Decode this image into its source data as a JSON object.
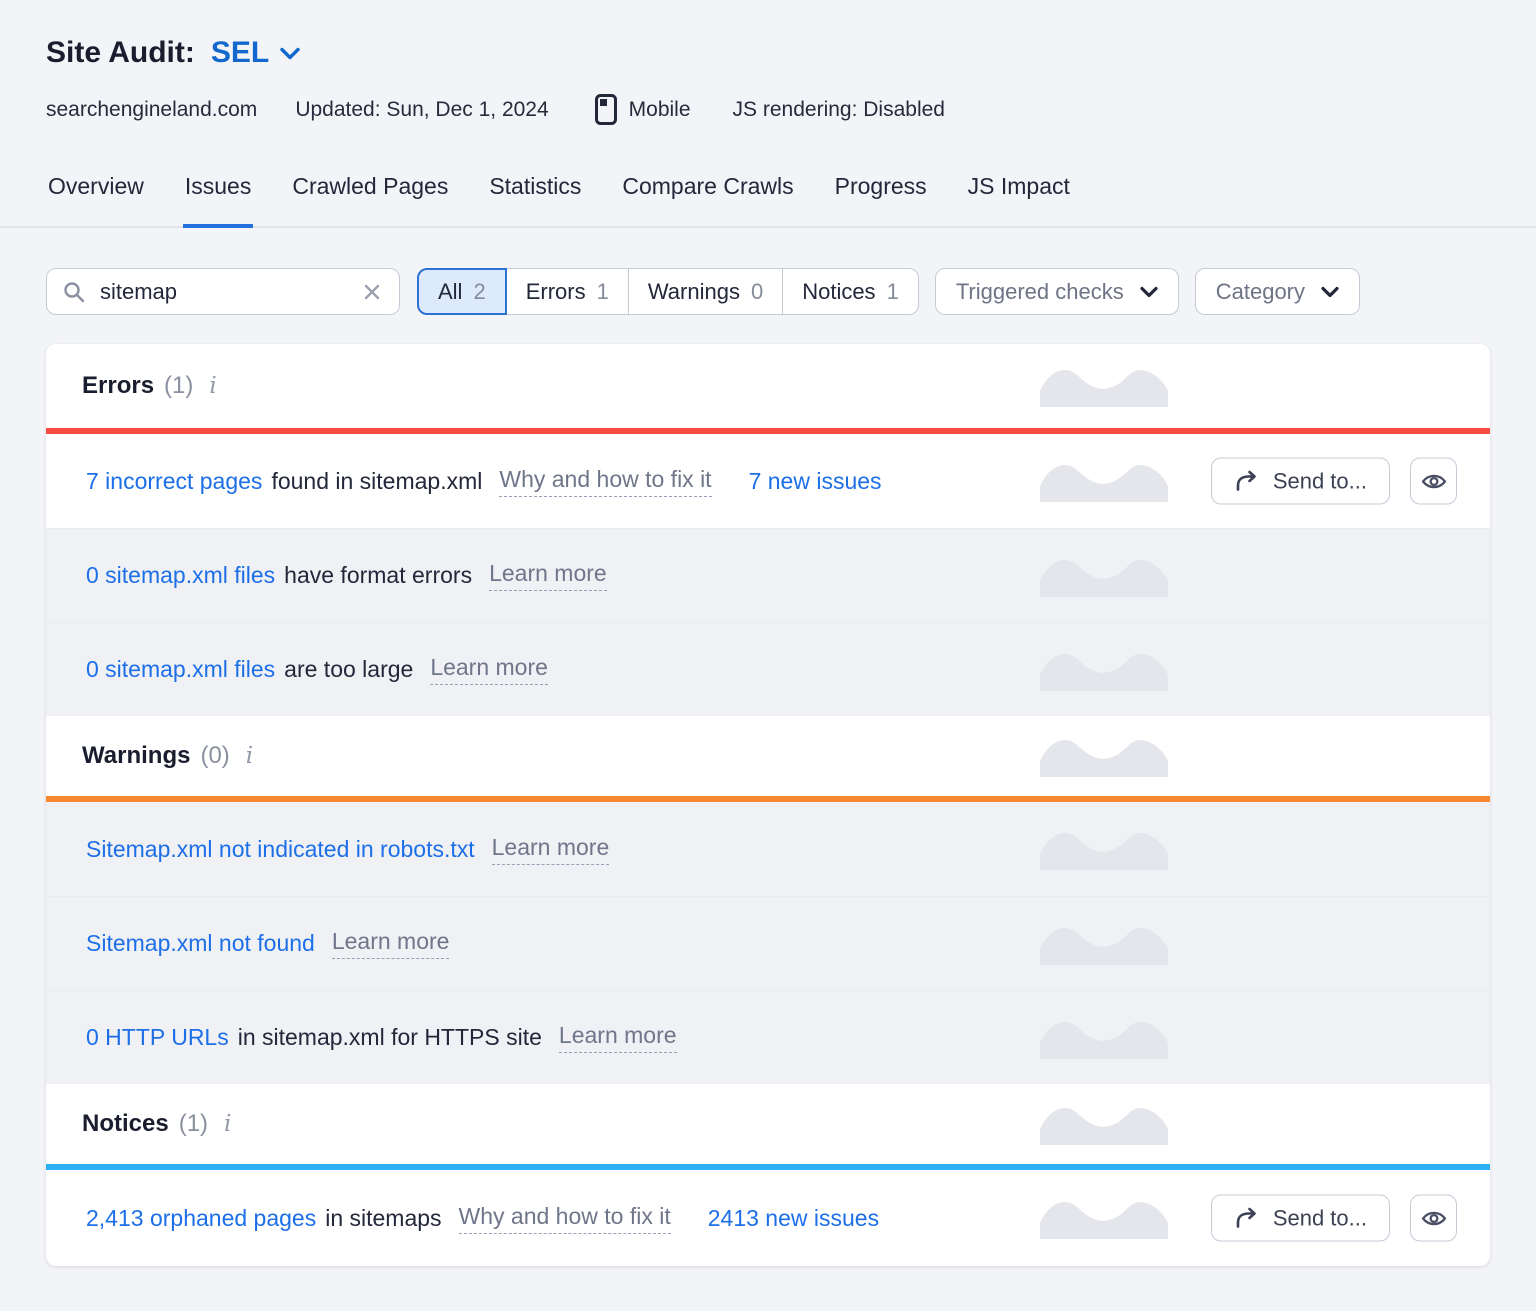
{
  "page": {
    "title_prefix": "Site Audit:",
    "project": "SEL",
    "domain": "searchengineland.com",
    "updated": "Updated: Sun, Dec 1, 2024",
    "device": "Mobile",
    "js_rendering": "JS rendering: Disabled"
  },
  "tabs": [
    {
      "label": "Overview",
      "active": false
    },
    {
      "label": "Issues",
      "active": true
    },
    {
      "label": "Crawled Pages",
      "active": false
    },
    {
      "label": "Statistics",
      "active": false
    },
    {
      "label": "Compare Crawls",
      "active": false
    },
    {
      "label": "Progress",
      "active": false
    },
    {
      "label": "JS Impact",
      "active": false
    }
  ],
  "filters": {
    "search": {
      "value": "sitemap"
    },
    "segments": [
      {
        "label": "All",
        "count": "2",
        "selected": true
      },
      {
        "label": "Errors",
        "count": "1",
        "selected": false
      },
      {
        "label": "Warnings",
        "count": "0",
        "selected": false
      },
      {
        "label": "Notices",
        "count": "1",
        "selected": false
      }
    ],
    "triggered_checks_label": "Triggered checks",
    "category_label": "Category"
  },
  "actions": {
    "send_to": "Send to..."
  },
  "colors": {
    "link_blue": "#1d6fe8",
    "error_accent": "#fa4b42",
    "warning_accent": "#f8872e",
    "notice_accent": "#2db1f5"
  },
  "sections": [
    {
      "title": "Errors",
      "count": "(1)",
      "accent_color": "#fa4b42",
      "rows": [
        {
          "link": "7 incorrect pages",
          "text": "found in sitemap.xml",
          "help": "Why and how to fix it",
          "new_issues": "7 new issues"
        },
        {
          "link": "0 sitemap.xml files",
          "text": "have format errors",
          "help": "Learn more"
        },
        {
          "link": "0 sitemap.xml files",
          "text": "are too large",
          "help": "Learn more"
        }
      ]
    },
    {
      "title": "Warnings",
      "count": "(0)",
      "accent_color": "#f8872e",
      "rows": [
        {
          "link": "Sitemap.xml not indicated in robots.txt",
          "help": "Learn more"
        },
        {
          "link": "Sitemap.xml not found",
          "help": "Learn more"
        },
        {
          "link": "0 HTTP URLs",
          "text": "in sitemap.xml for HTTPS site",
          "help": "Learn more"
        }
      ]
    },
    {
      "title": "Notices",
      "count": "(1)",
      "accent_color": "#2db1f5",
      "rows": [
        {
          "link": "2,413 orphaned pages",
          "text": "in sitemaps",
          "help": "Why and how to fix it",
          "new_issues": "2413 new issues"
        }
      ]
    }
  ]
}
